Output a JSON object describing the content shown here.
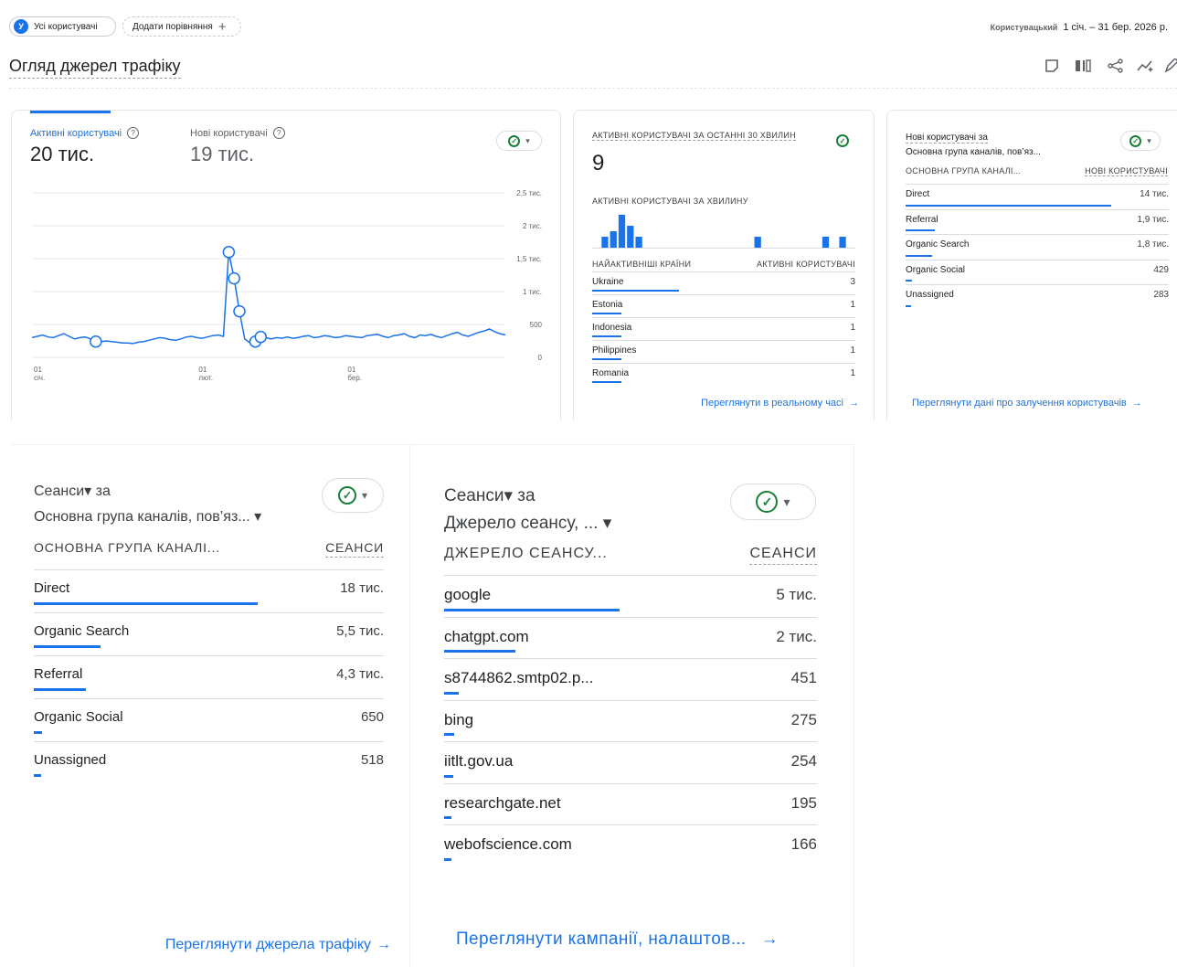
{
  "header": {
    "segment_avatar": "У",
    "segment_label": "Усі користувачі",
    "compare_label": "Додати порівняння",
    "compare_plus": "+",
    "range_type": "Користувацький",
    "date_range": "1 січ. – 31 бер. 2026 р.",
    "page_title": "Огляд джерел трафіку"
  },
  "overview": {
    "tab1_label": "Активні користувачі",
    "tab1_value": "20 тис.",
    "tab2_label": "Нові користувачі",
    "tab2_value": "19 тис.",
    "help_glyph": "?",
    "check_glyph": "✓",
    "dropdown_glyph": "▾",
    "y_ticks": [
      "2,5 тис.",
      "2 тис.",
      "1,5 тис.",
      "1 тис.",
      "500",
      "0"
    ],
    "x_ticks": [
      {
        "day": "01",
        "month": "січ."
      },
      {
        "day": "01",
        "month": "лют."
      },
      {
        "day": "01",
        "month": "бер."
      }
    ]
  },
  "chart_data": {
    "type": "line",
    "series": [
      {
        "values": [
          300,
          320,
          340,
          310,
          300,
          330,
          360,
          320,
          280,
          300,
          310,
          280,
          260,
          240,
          250,
          240,
          230,
          220,
          220,
          210,
          230,
          240,
          260,
          280,
          300,
          290,
          270,
          260,
          280,
          310,
          320,
          300,
          290,
          310,
          330,
          340,
          320,
          1600,
          1200,
          700,
          280,
          220,
          240,
          310,
          300,
          280,
          300,
          290,
          310,
          290,
          300,
          320,
          330,
          300,
          310,
          330,
          320,
          300,
          310,
          330,
          320,
          310,
          300,
          330,
          340,
          350,
          320,
          300,
          330,
          340,
          360,
          320,
          300,
          340,
          330,
          350,
          320,
          300,
          330,
          360,
          380,
          340,
          320,
          350,
          380,
          400,
          430,
          390,
          360,
          340
        ]
      }
    ],
    "markers": [
      {
        "index": 12,
        "value": 240
      },
      {
        "index": 37,
        "value": 1600
      },
      {
        "index": 38,
        "value": 1200
      },
      {
        "index": 39,
        "value": 700
      },
      {
        "index": 42,
        "value": 240
      },
      {
        "index": 43,
        "value": 310
      }
    ],
    "ylim": [
      0,
      2500
    ],
    "yticks": [
      "2,5 тис.",
      "2 тис.",
      "1,5 тис.",
      "1 тис.",
      "500",
      "0"
    ],
    "xticks": [
      "01 січ.",
      "01 лют.",
      "01 бер."
    ],
    "grid": true
  },
  "realtime": {
    "title": "Активні користувачі за останні 30 хвилин",
    "value": "9",
    "subtitle": "Активні користувачі за хвилину",
    "minute_bars": [
      0,
      1,
      1.5,
      3,
      2,
      1,
      0,
      0,
      0,
      0,
      0,
      0,
      0,
      0,
      0,
      0,
      0,
      0,
      0,
      1,
      0,
      0,
      0,
      0,
      0,
      0,
      0,
      1,
      0,
      1,
      0
    ],
    "col1": "Найактивніші країни",
    "col2": "Активні користувачі",
    "rows": [
      {
        "name": "Ukraine",
        "value": "3",
        "share": 0.33
      },
      {
        "name": "Estonia",
        "value": "1",
        "share": 0.11
      },
      {
        "name": "Indonesia",
        "value": "1",
        "share": 0.11
      },
      {
        "name": "Philippines",
        "value": "1",
        "share": 0.11
      },
      {
        "name": "Romania",
        "value": "1",
        "share": 0.11
      }
    ],
    "link": "Переглянути в реальному часі",
    "arrow": "→"
  },
  "new_users": {
    "title_line1": "Нові користувачі за",
    "title_line2": "Основна група каналів, пов’яз...",
    "col1": "Основна група каналі...",
    "col2": "Нові користувачі",
    "rows": [
      {
        "name": "Direct",
        "value": "14 тис.",
        "share": 0.78
      },
      {
        "name": "Referral",
        "value": "1,9 тис.",
        "share": 0.11
      },
      {
        "name": "Organic Search",
        "value": "1,8 тис.",
        "share": 0.1
      },
      {
        "name": "Organic Social",
        "value": "429",
        "share": 0.024
      },
      {
        "name": "Unassigned",
        "value": "283",
        "share": 0.016
      }
    ],
    "link": "Переглянути дані про залучення користувачів",
    "arrow": "→"
  },
  "sessions_channel": {
    "title_line1": "Сеанси▾ за",
    "title_line2": "Основна група каналів, пов’яз... ▾",
    "col1": "Основна група каналі...",
    "col2": "Сеанси",
    "rows": [
      {
        "name": "Direct",
        "value": "18 тис.",
        "share": 0.64
      },
      {
        "name": "Organic Search",
        "value": "5,5 тис.",
        "share": 0.19
      },
      {
        "name": "Referral",
        "value": "4,3 тис.",
        "share": 0.15
      },
      {
        "name": "Organic Social",
        "value": "650",
        "share": 0.023
      },
      {
        "name": "Unassigned",
        "value": "518",
        "share": 0.018
      }
    ],
    "link": "Переглянути джерела трафіку",
    "arrow": "→"
  },
  "sessions_source": {
    "title_line1": "Сеанси▾ за",
    "title_line2": "Джерело сеансу, ... ▾",
    "col1": "Джерело сеансу...",
    "col2": "Сеанси",
    "rows": [
      {
        "name": "google",
        "value": "5 тис.",
        "share": 0.47
      },
      {
        "name": "chatgpt.com",
        "value": "2 тис.",
        "share": 0.19
      },
      {
        "name": "s8744862.smtp02.p...",
        "value": "451",
        "share": 0.04
      },
      {
        "name": "bing",
        "value": "275",
        "share": 0.026
      },
      {
        "name": "iitlt.gov.ua",
        "value": "254",
        "share": 0.024
      },
      {
        "name": "researchgate.net",
        "value": "195",
        "share": 0.018
      },
      {
        "name": "webofscience.com",
        "value": "166",
        "share": 0.016
      }
    ],
    "link": "Переглянути кампанії, налаштов...",
    "arrow": "→"
  },
  "toolbar_icons": [
    "note-icon",
    "compare-columns-icon",
    "share-icon",
    "insights-icon",
    "edit-icon"
  ]
}
